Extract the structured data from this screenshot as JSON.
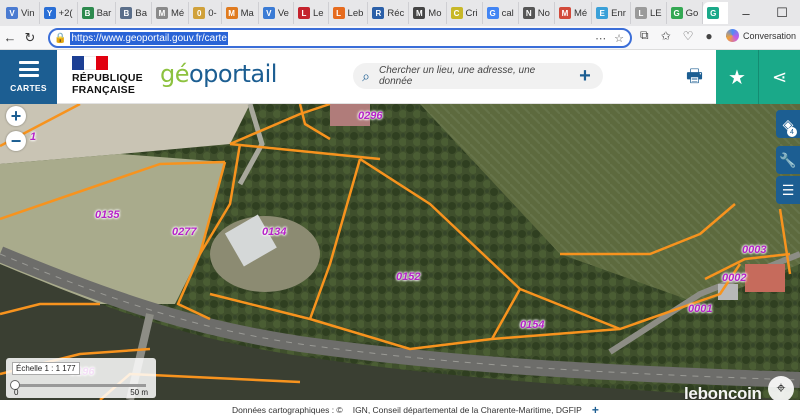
{
  "browser": {
    "tabs": [
      {
        "label": "Vin",
        "color": "#4b7bd1",
        "glyph": "V"
      },
      {
        "label": "+2(",
        "color": "#2a6fd6",
        "glyph": "Y"
      },
      {
        "label": "Bar",
        "color": "#2d8a4e",
        "glyph": "B"
      },
      {
        "label": "Ba",
        "color": "#5a6e8a",
        "glyph": "B"
      },
      {
        "label": "Mé",
        "color": "#8a8a8a",
        "glyph": "M"
      },
      {
        "label": "0-",
        "color": "#d0a13a",
        "glyph": "0"
      },
      {
        "label": "Ma",
        "color": "#e07b1f",
        "glyph": "M"
      },
      {
        "label": "Ve",
        "color": "#3a7bd5",
        "glyph": "V"
      },
      {
        "label": "Le",
        "color": "#c4232d",
        "glyph": "L"
      },
      {
        "label": "Leb",
        "color": "#e66b1e",
        "glyph": "L"
      },
      {
        "label": "Réc",
        "color": "#2a5fa8",
        "glyph": "R"
      },
      {
        "label": "Mo",
        "color": "#444444",
        "glyph": "M"
      },
      {
        "label": "Cri",
        "color": "#c8b828",
        "glyph": "C"
      },
      {
        "label": "cal",
        "color": "#4285f4",
        "glyph": "G"
      },
      {
        "label": "No",
        "color": "#555555",
        "glyph": "N"
      },
      {
        "label": "Mé",
        "color": "#d24a3a",
        "glyph": "M"
      },
      {
        "label": "Enr",
        "color": "#3aa0d8",
        "glyph": "E"
      },
      {
        "label": "LE",
        "color": "#9a9a9a",
        "glyph": "L"
      },
      {
        "label": "Go",
        "color": "#34a853",
        "glyph": "G"
      }
    ],
    "active_tab": {
      "label": "",
      "color": "#1aa989",
      "glyph": "G"
    },
    "new_tab": "+",
    "url": "https://www.geoportail.gouv.fr/carte",
    "conversation": "Conversation"
  },
  "header": {
    "menu_label": "CARTES",
    "republique": "RÉPUBLIQUE",
    "francaise": "FRANÇAISE",
    "logo_g": "gé",
    "logo_rest": "oportail",
    "search_placeholder": "Chercher un lieu, une adresse, une donnée"
  },
  "map": {
    "parcels": [
      {
        "id": "0296"
      },
      {
        "id": "0135"
      },
      {
        "id": "0277"
      },
      {
        "id": "0134"
      },
      {
        "id": "0152"
      },
      {
        "id": "0154"
      },
      {
        "id": "0003"
      },
      {
        "id": "0002"
      },
      {
        "id": "0001"
      },
      {
        "id": "0196"
      },
      {
        "id": "1"
      }
    ],
    "scale_label": "Échelle 1 : 1 177",
    "scale_min": "0",
    "scale_max": "50 m",
    "layers_count": "4",
    "watermark": "leboncoin",
    "parcel_color": "#f7931e",
    "label_color": "#b623c8"
  },
  "footer": {
    "credits": "Données cartographiques : ©",
    "sources": "IGN, Conseil départemental de la Charente-Maritime, DGFIP",
    "more": "+"
  }
}
